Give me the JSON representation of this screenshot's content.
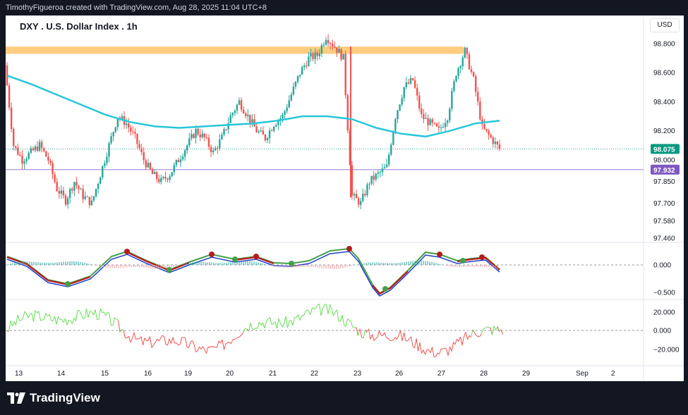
{
  "header": {
    "attribution": "TimothyFigueroa created with TradingView.com, Aug 28, 2025 11:04 UTC+8"
  },
  "chart": {
    "title": "DXY . U.S. Dollar Index . 1h",
    "currency": "USD"
  },
  "footer": {
    "brand": "TradingView"
  },
  "colors": {
    "background": "#ffffff",
    "frame": "#131722",
    "up_candle": "#26a69a",
    "down_candle": "#ef5350",
    "ma_line": "#26c6da",
    "resistance_band": "#ffcc80",
    "support_line": "#9c7bd8",
    "current_price_label": "#089981",
    "support_price_label": "#7e57c2",
    "osc_fast": "#43a047",
    "osc_slow": "#1e40c8",
    "osc_red": "#b71c1c",
    "rsi_green": "#66dd55",
    "rsi_red": "#ef5350"
  },
  "chart_data": {
    "type": "candlestick",
    "symbol": "DXY",
    "interval": "1h",
    "price_ticks": [
      "98.800",
      "98.600",
      "98.400",
      "98.200",
      "98.000",
      "97.850",
      "97.700",
      "97.580",
      "97.460"
    ],
    "current_price": "98.075",
    "support_level": "97.932",
    "resistance_band_range": [
      98.73,
      98.78
    ],
    "x_ticks": [
      "13",
      "14",
      "15",
      "16",
      "19",
      "20",
      "21",
      "22",
      "23",
      "26",
      "27",
      "28",
      "29",
      "Sep",
      "2"
    ],
    "approx_close_path": [
      98.65,
      98.1,
      98.0,
      98.05,
      98.1,
      98.0,
      97.8,
      97.72,
      97.85,
      97.75,
      97.7,
      97.9,
      98.1,
      98.3,
      98.25,
      98.15,
      98.0,
      97.9,
      97.85,
      97.9,
      98.0,
      98.1,
      98.2,
      98.15,
      98.05,
      98.15,
      98.3,
      98.4,
      98.3,
      98.2,
      98.15,
      98.25,
      98.3,
      98.45,
      98.6,
      98.7,
      98.72,
      98.85,
      98.78,
      98.7,
      97.75,
      97.7,
      97.85,
      97.9,
      97.95,
      98.3,
      98.5,
      98.55,
      98.3,
      98.25,
      98.2,
      98.3,
      98.6,
      98.75,
      98.55,
      98.22,
      98.15,
      98.075
    ],
    "ma_path": [
      98.58,
      98.52,
      98.45,
      98.38,
      98.31,
      98.26,
      98.23,
      98.22,
      98.23,
      98.24,
      98.25,
      98.27,
      98.3,
      98.3,
      98.28,
      98.22,
      98.18,
      98.16,
      98.2,
      98.25,
      98.27
    ],
    "macd_panel": {
      "ticks": [
        "0.000",
        "−0.500"
      ]
    },
    "rsi_panel": {
      "ticks": [
        "20.000",
        "0.000",
        "−20.000"
      ]
    }
  }
}
